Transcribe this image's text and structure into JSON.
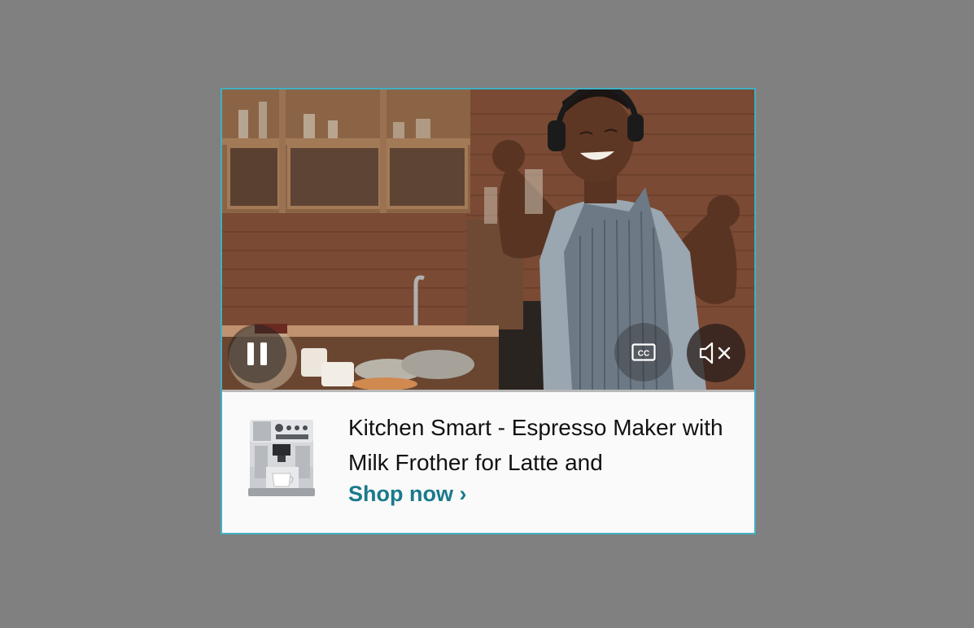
{
  "ad": {
    "product_title": "Kitchen Smart - Espresso Maker with Milk Frother for Latte and",
    "cta_label": "Shop now ›",
    "accent_color": "#1a7a8c",
    "border_color": "#3fb0c2"
  },
  "video_controls": {
    "pause_icon": "pause-icon",
    "captions_icon": "closed-captions-icon",
    "captions_label": "CC",
    "mute_icon": "speaker-muted-icon"
  }
}
